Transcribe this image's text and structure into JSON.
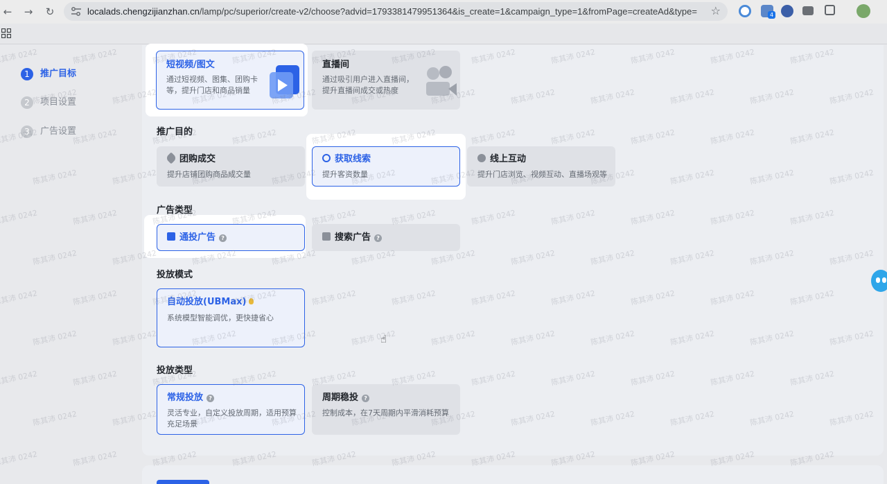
{
  "browser": {
    "url_host": "localads.chengzijianzhan.cn",
    "url_path": "/lamp/pc/superior/create-v2/choose?advid=1793381479951364&is_create=1&campaign_type=1&fromPage=createAd&type=1...",
    "extension_badge": "4"
  },
  "steps": [
    {
      "num": "1",
      "label": "推广目标"
    },
    {
      "num": "2",
      "label": "项目设置"
    },
    {
      "num": "3",
      "label": "广告设置"
    }
  ],
  "format_cards": [
    {
      "title": "短视频/图文",
      "desc": "通过短视频、图集、团购卡等，提升门店和商品销量"
    },
    {
      "title": "直播间",
      "desc": "通过吸引用户进入直播间，提升直播间成交或热度"
    }
  ],
  "purpose": {
    "title": "推广目的",
    "cards": [
      {
        "title": "团购成交",
        "desc": "提升店铺团购商品成交量"
      },
      {
        "title": "获取线索",
        "desc": "提升客资数量"
      },
      {
        "title": "线上互动",
        "desc": "提升门店浏览、视频互动、直播场观等"
      }
    ]
  },
  "ad_type": {
    "title": "广告类型",
    "cards": [
      {
        "title": "通投广告"
      },
      {
        "title": "搜索广告"
      }
    ]
  },
  "mode": {
    "title": "投放模式",
    "cards": [
      {
        "title": "自动投放(UBMax)",
        "desc": "系统模型智能调优，更快捷省心"
      }
    ]
  },
  "delivery_type": {
    "title": "投放类型",
    "cards": [
      {
        "title": "常规投放",
        "desc": "灵活专业，自定义投放周期，适用预算充足场景"
      },
      {
        "title": "周期稳投",
        "desc": "控制成本，在7天周期内平滑消耗预算"
      }
    ]
  },
  "watermark": "陈其沛 0242",
  "colors": {
    "accent": "#2c62e6"
  }
}
